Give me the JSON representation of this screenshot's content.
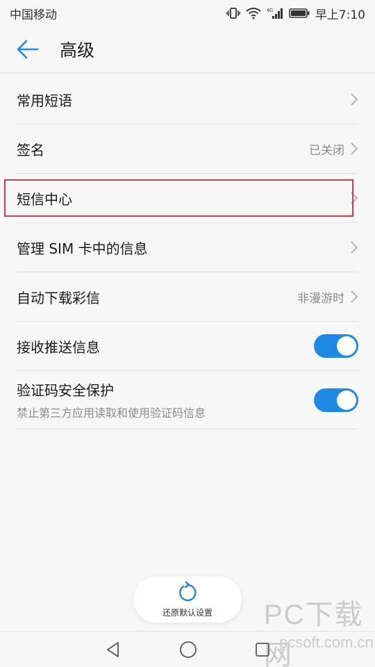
{
  "status": {
    "carrier": "中国移动",
    "network": "4G",
    "time": "早上7:10"
  },
  "header": {
    "title": "高级"
  },
  "rows": [
    {
      "label": "常用短语",
      "value": ""
    },
    {
      "label": "签名",
      "value": "已关闭"
    },
    {
      "label": "短信中心",
      "value": ""
    },
    {
      "label": "管理 SIM 卡中的信息",
      "value": ""
    },
    {
      "label": "自动下载彩信",
      "value": "非漫游时"
    },
    {
      "label": "接收推送信息",
      "toggle": true
    },
    {
      "label": "验证码安全保护",
      "sub": "禁止第三方应用读取和使用验证码信息",
      "toggle": true
    }
  ],
  "restore": {
    "label": "还原默认设置"
  },
  "watermark": {
    "big": "PC下载网",
    "small": "pcsoft.com.cn"
  },
  "colors": {
    "accent": "#1e88e5",
    "highlight": "#d63b45",
    "background": "#f7f7f7"
  }
}
